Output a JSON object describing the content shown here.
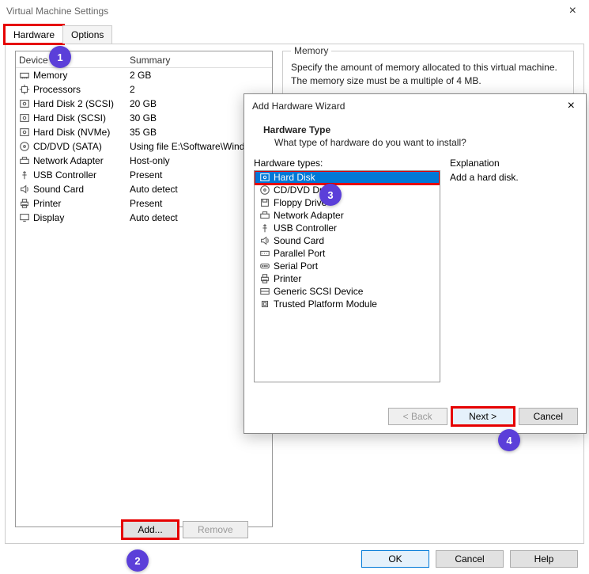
{
  "window": {
    "title": "Virtual Machine Settings"
  },
  "tabs": {
    "hardware": "Hardware",
    "options": "Options"
  },
  "device_table": {
    "col_device": "Device",
    "col_summary": "Summary",
    "rows": [
      {
        "icon": "memory-icon",
        "name": "Memory",
        "summary": "2 GB"
      },
      {
        "icon": "cpu-icon",
        "name": "Processors",
        "summary": "2"
      },
      {
        "icon": "disk-icon",
        "name": "Hard Disk 2 (SCSI)",
        "summary": "20 GB"
      },
      {
        "icon": "disk-icon",
        "name": "Hard Disk (SCSI)",
        "summary": "30 GB"
      },
      {
        "icon": "disk-icon",
        "name": "Hard Disk (NVMe)",
        "summary": "35 GB"
      },
      {
        "icon": "cd-icon",
        "name": "CD/DVD (SATA)",
        "summary": "Using file E:\\Software\\Windo..."
      },
      {
        "icon": "net-icon",
        "name": "Network Adapter",
        "summary": "Host-only"
      },
      {
        "icon": "usb-icon",
        "name": "USB Controller",
        "summary": "Present"
      },
      {
        "icon": "sound-icon",
        "name": "Sound Card",
        "summary": "Auto detect"
      },
      {
        "icon": "printer-icon",
        "name": "Printer",
        "summary": "Present"
      },
      {
        "icon": "display-icon",
        "name": "Display",
        "summary": "Auto detect"
      }
    ]
  },
  "memory_box": {
    "legend": "Memory",
    "text": "Specify the amount of memory allocated to this virtual machine. The memory size must be a multiple of 4 MB."
  },
  "buttons": {
    "add": "Add...",
    "remove": "Remove",
    "ok": "OK",
    "cancel": "Cancel",
    "help": "Help",
    "back": "< Back",
    "next": "Next >"
  },
  "wizard": {
    "title": "Add Hardware Wizard",
    "heading": "Hardware Type",
    "subheading": "What type of hardware do you want to install?",
    "list_label": "Hardware types:",
    "explanation_label": "Explanation",
    "explanation_text": "Add a hard disk.",
    "items": [
      {
        "icon": "disk-icon",
        "label": "Hard Disk",
        "selected": true
      },
      {
        "icon": "cd-icon",
        "label": "CD/DVD Drive"
      },
      {
        "icon": "floppy-icon",
        "label": "Floppy Drive"
      },
      {
        "icon": "net-icon",
        "label": "Network Adapter"
      },
      {
        "icon": "usb-icon",
        "label": "USB Controller"
      },
      {
        "icon": "sound-icon",
        "label": "Sound Card"
      },
      {
        "icon": "parallel-icon",
        "label": "Parallel Port"
      },
      {
        "icon": "serial-icon",
        "label": "Serial Port"
      },
      {
        "icon": "printer-icon",
        "label": "Printer"
      },
      {
        "icon": "scsi-icon",
        "label": "Generic SCSI Device"
      },
      {
        "icon": "tpm-icon",
        "label": "Trusted Platform Module"
      }
    ]
  },
  "markers": {
    "m1": "1",
    "m2": "2",
    "m3": "3",
    "m4": "4"
  }
}
